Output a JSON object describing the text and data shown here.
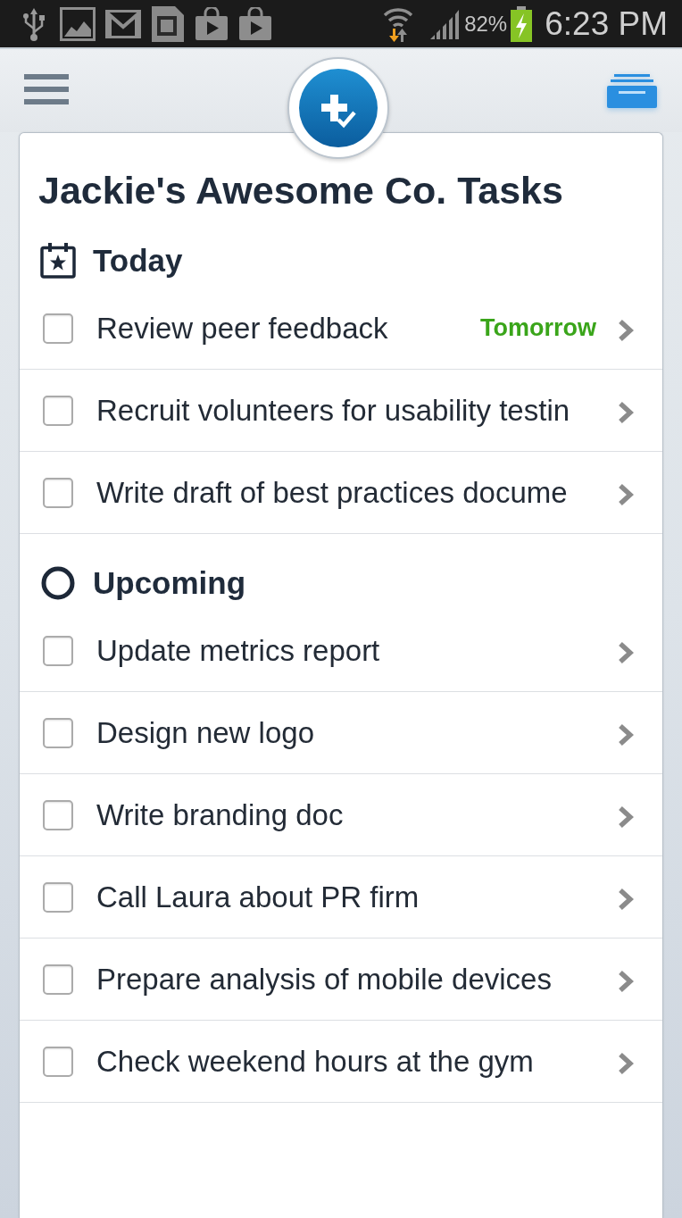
{
  "status_bar": {
    "battery": "82%",
    "time": "6:23 PM"
  },
  "list": {
    "title": "Jackie's Awesome Co. Tasks",
    "sections": [
      {
        "kind": "today",
        "title": "Today",
        "tasks": [
          {
            "title": "Review peer feedback",
            "checked": false,
            "due": "Tomorrow"
          },
          {
            "title": "Recruit volunteers for usability testin",
            "checked": false
          },
          {
            "title": "Write draft of best practices docume",
            "checked": false
          }
        ]
      },
      {
        "kind": "upcoming",
        "title": "Upcoming",
        "tasks": [
          {
            "title": "Update metrics report",
            "checked": false
          },
          {
            "title": "Design new logo",
            "checked": false
          },
          {
            "title": "Write branding doc",
            "checked": false
          },
          {
            "title": "Call Laura about PR firm",
            "checked": false
          },
          {
            "title": "Prepare analysis of mobile devices",
            "checked": false
          },
          {
            "title": "Check weekend hours at the gym",
            "checked": false
          }
        ]
      }
    ]
  }
}
